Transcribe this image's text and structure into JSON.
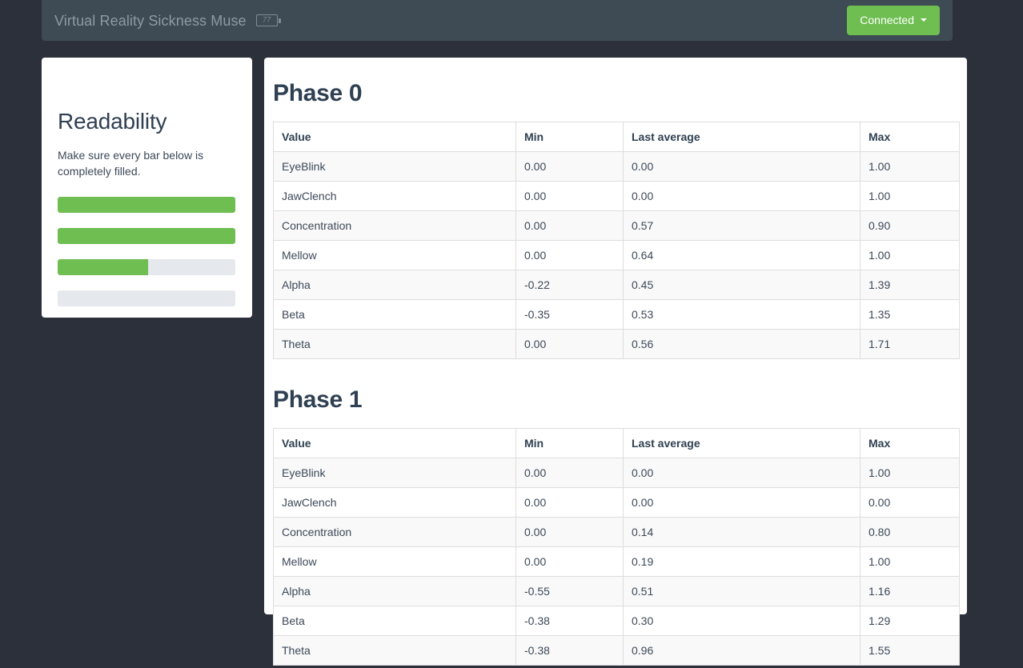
{
  "navbar": {
    "brand_title": "Virtual Reality Sickness Muse",
    "battery_icon": "battery-icon",
    "battery_level": "77",
    "connect_button_label": "Connected",
    "caret_icon": "caret-down-icon",
    "accent_green": "#6ebe51",
    "navbar_bg": "#3e4b54",
    "page_bg": "#2b303b"
  },
  "sidebar": {
    "title": "Readability",
    "description": "Make sure every bar below is completely filled.",
    "bars": [
      {
        "name": "readability-bar-1",
        "percent": 100
      },
      {
        "name": "readability-bar-2",
        "percent": 100
      },
      {
        "name": "readability-bar-3",
        "percent": 51
      },
      {
        "name": "readability-bar-4",
        "percent": 0
      }
    ],
    "bar_fill_color": "#6ebe51",
    "bar_track_color": "#e5e8ec"
  },
  "main": {
    "columns": [
      "Value",
      "Min",
      "Last average",
      "Max"
    ],
    "phases": [
      {
        "title": "Phase 0",
        "rows": [
          {
            "value": "EyeBlink",
            "min": "0.00",
            "avg": "0.00",
            "max": "1.00"
          },
          {
            "value": "JawClench",
            "min": "0.00",
            "avg": "0.00",
            "max": "1.00"
          },
          {
            "value": "Concentration",
            "min": "0.00",
            "avg": "0.57",
            "max": "0.90"
          },
          {
            "value": "Mellow",
            "min": "0.00",
            "avg": "0.64",
            "max": "1.00"
          },
          {
            "value": "Alpha",
            "min": "-0.22",
            "avg": "0.45",
            "max": "1.39"
          },
          {
            "value": "Beta",
            "min": "-0.35",
            "avg": "0.53",
            "max": "1.35"
          },
          {
            "value": "Theta",
            "min": "0.00",
            "avg": "0.56",
            "max": "1.71"
          }
        ]
      },
      {
        "title": "Phase 1",
        "rows": [
          {
            "value": "EyeBlink",
            "min": "0.00",
            "avg": "0.00",
            "max": "1.00"
          },
          {
            "value": "JawClench",
            "min": "0.00",
            "avg": "0.00",
            "max": "0.00"
          },
          {
            "value": "Concentration",
            "min": "0.00",
            "avg": "0.14",
            "max": "0.80"
          },
          {
            "value": "Mellow",
            "min": "0.00",
            "avg": "0.19",
            "max": "1.00"
          },
          {
            "value": "Alpha",
            "min": "-0.55",
            "avg": "0.51",
            "max": "1.16"
          },
          {
            "value": "Beta",
            "min": "-0.38",
            "avg": "0.30",
            "max": "1.29"
          },
          {
            "value": "Theta",
            "min": "-0.38",
            "avg": "0.96",
            "max": "1.55"
          }
        ]
      }
    ]
  }
}
